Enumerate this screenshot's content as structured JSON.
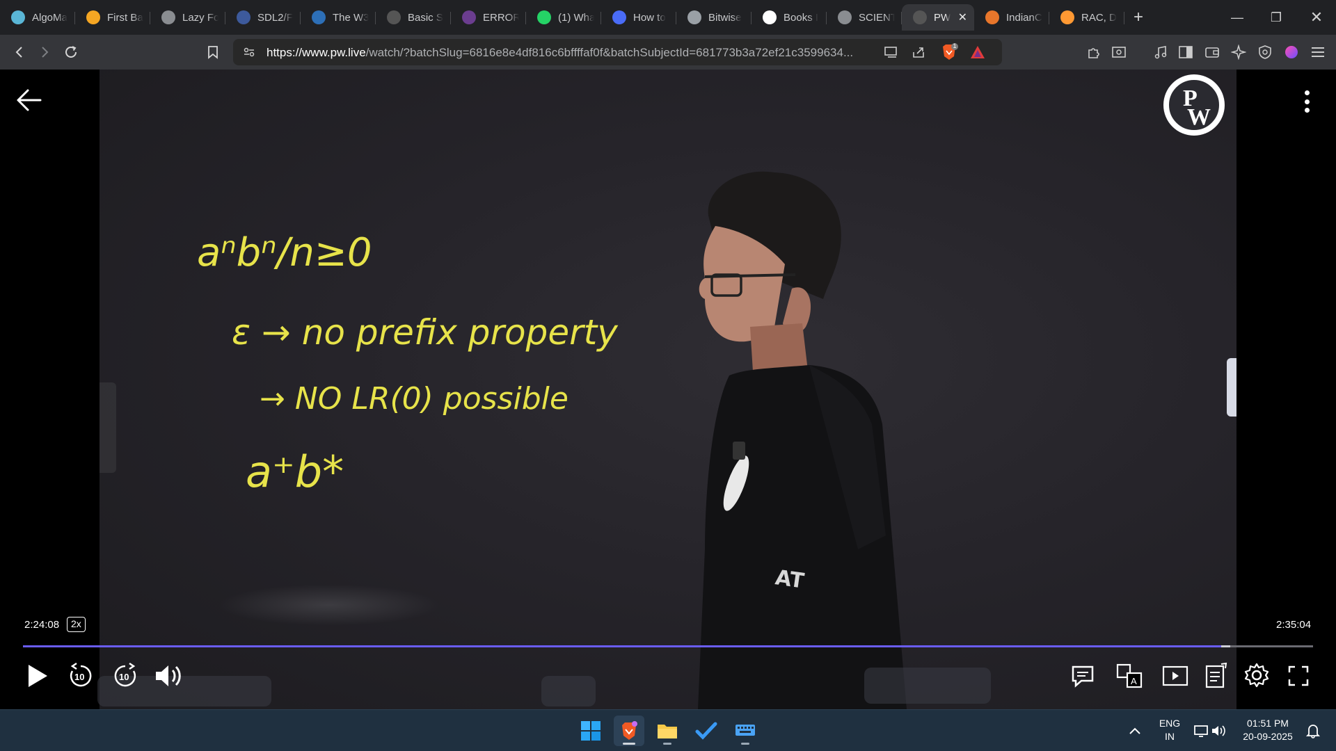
{
  "browser": {
    "tabs": [
      {
        "label": "AlgoMa",
        "icon": "algomaster-icon",
        "color": "#5ab6d6"
      },
      {
        "label": "First Ba",
        "icon": "first-bad-version-icon",
        "color": "#f5a623"
      },
      {
        "label": "Lazy Fo",
        "icon": "globe-icon",
        "color": "#8a8d91"
      },
      {
        "label": "SDL2/F",
        "icon": "sdl-icon",
        "color": "#3d5a9c"
      },
      {
        "label": "The W3",
        "icon": "w3-icon",
        "color": "#2d6fb7"
      },
      {
        "label": "Basic S",
        "icon": "basic-syntax-icon",
        "color": "#555"
      },
      {
        "label": "ERROR",
        "icon": "error-site-icon",
        "color": "#6b3d8f"
      },
      {
        "label": "(1) Wha",
        "icon": "whatsapp-icon",
        "color": "#25d366"
      },
      {
        "label": "How to",
        "icon": "how-to-icon",
        "color": "#4a6cf7"
      },
      {
        "label": "Bitwise",
        "icon": "bitwise-icon",
        "color": "#9aa0a6"
      },
      {
        "label": "Books I",
        "icon": "google-icon",
        "color": "#ffffff"
      },
      {
        "label": "SCIENT",
        "icon": "globe-icon",
        "color": "#8a8d91"
      },
      {
        "label": "PW",
        "icon": "pw-icon",
        "color": "#555",
        "active": true
      },
      {
        "label": "IndianC",
        "icon": "indianc-icon",
        "color": "#e8762b"
      },
      {
        "label": "RAC, D",
        "icon": "india-flag-icon",
        "color": "#ff9933"
      }
    ],
    "url_domain": "https://www.pw.live",
    "url_rest": "/watch/?batchSlug=6816e8e4df816c6bffffaf0f&batchSubjectId=681773b3a72ef21c3599634...",
    "brave_badge": "1"
  },
  "player": {
    "current_time": "2:24:08",
    "speed": "2x",
    "duration": "2:35:04",
    "progress_fraction": 0.929,
    "buffer_fraction": 0.936,
    "board": {
      "line1": "aⁿbⁿ/n≥0",
      "line2": "ε → no prefix property",
      "line3": "→ NO LR(0) possible",
      "line4": "a⁺b*"
    },
    "skip_back_label": "10",
    "skip_fwd_label": "10"
  },
  "taskbar": {
    "lang_top": "ENG",
    "lang_bottom": "IN",
    "time": "01:51 PM",
    "date": "20-09-2025"
  }
}
